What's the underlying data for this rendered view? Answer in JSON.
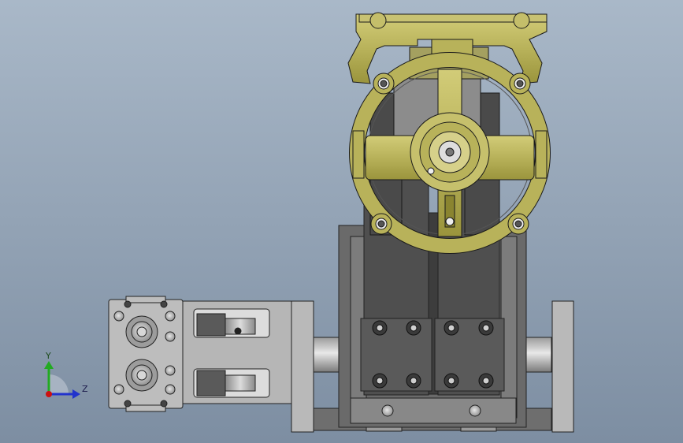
{
  "viewport": {
    "background_top": "#a9b8c8",
    "background_bottom": "#7d8ea2"
  },
  "triad": {
    "y_label": "Y",
    "z_label": "Z",
    "y_color": "#22aa22",
    "z_color": "#2233cc",
    "origin_color": "#cc1111"
  },
  "colors": {
    "brass": "#b8b25a",
    "brass_dark": "#8a8430",
    "steel_dark": "#5c5c5c",
    "steel_mid": "#7c7c7c",
    "steel_light": "#aaaaaa",
    "plate": "#bcbcbc"
  }
}
